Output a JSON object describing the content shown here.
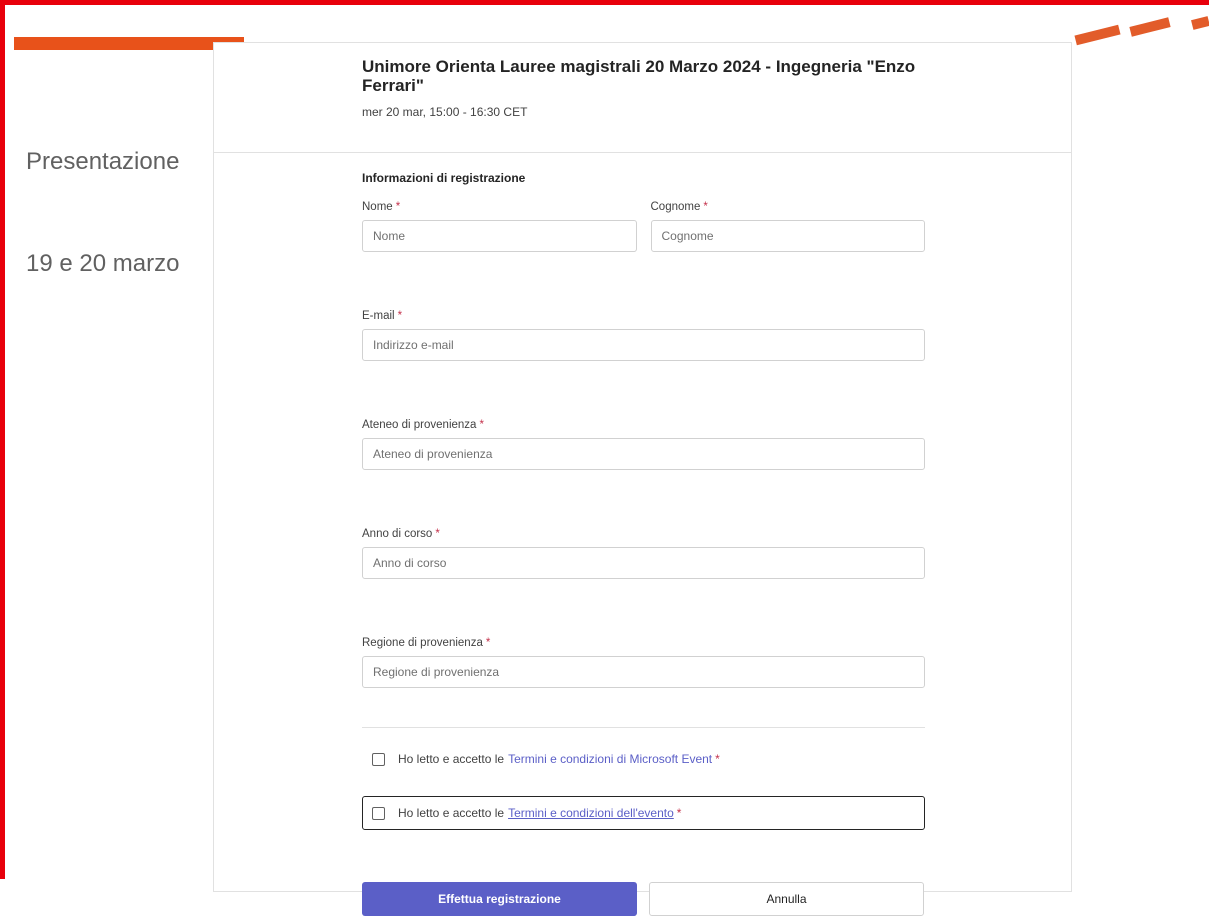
{
  "background": {
    "title_line1": "Presentazione",
    "title_line2": "19 e 20 marzo",
    "accent_color": "#e8521a"
  },
  "dialog": {
    "event_title": "Unimore Orienta Lauree magistrali 20 Marzo 2024 - Ingegneria \"Enzo Ferrari\"",
    "event_time": "mer 20 mar, 15:00 - 16:30 CET"
  },
  "form": {
    "section_title": "Informazioni di registrazione",
    "required_mark": "*",
    "first_name": {
      "label": "Nome",
      "placeholder": "Nome",
      "value": ""
    },
    "last_name": {
      "label": "Cognome",
      "placeholder": "Cognome",
      "value": ""
    },
    "email": {
      "label": "E-mail",
      "placeholder": "Indirizzo e-mail",
      "value": ""
    },
    "university": {
      "label": "Ateneo di provenienza",
      "placeholder": "Ateneo di provenienza",
      "value": ""
    },
    "year": {
      "label": "Anno di corso",
      "placeholder": "Anno di corso",
      "value": ""
    },
    "region": {
      "label": "Regione di provenienza",
      "placeholder": "Regione di provenienza",
      "value": ""
    },
    "terms_ms": {
      "prefix": "Ho letto e accetto le",
      "link": "Termini e condizioni di Microsoft Event",
      "checked": false
    },
    "terms_event": {
      "prefix": "Ho letto e accetto le",
      "link": "Termini e condizioni dell'evento",
      "checked": false
    },
    "submit_label": "Effettua registrazione",
    "cancel_label": "Annulla"
  },
  "colors": {
    "primary": "#5b5fc7",
    "required": "#c4314b",
    "frame": "#e8000b"
  }
}
